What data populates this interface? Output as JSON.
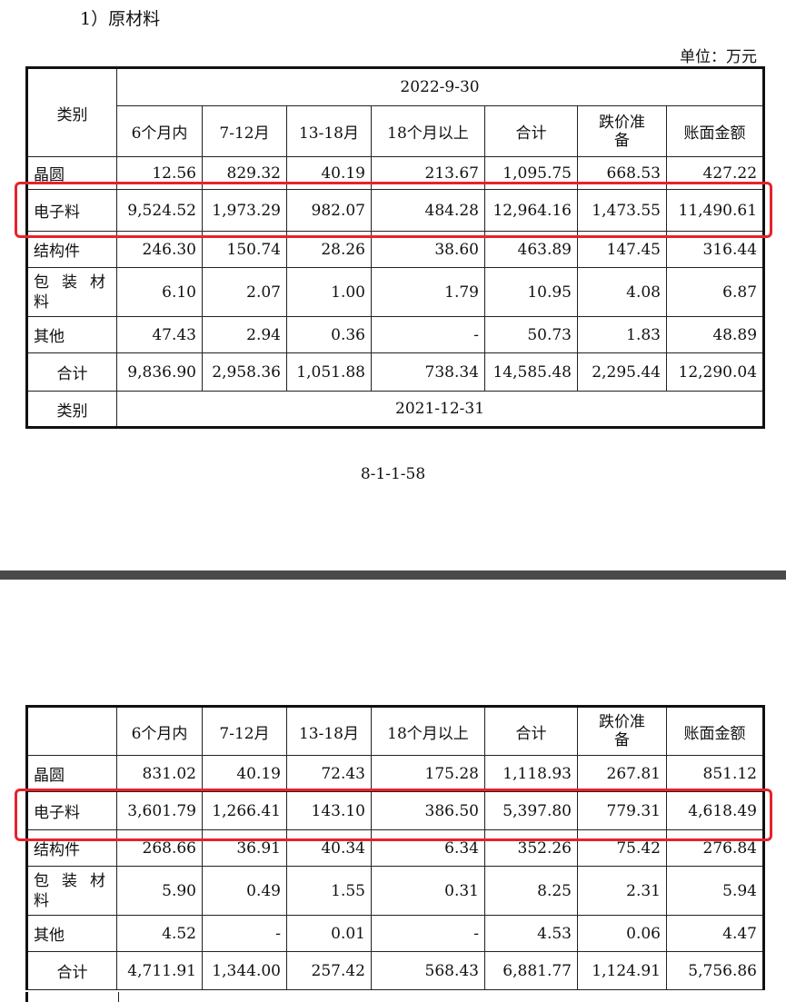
{
  "heading": "1）原材料",
  "unit": "单位：万元",
  "page_number": "8-1-1-58",
  "columns": [
    "6个月内",
    "7-12月",
    "13-18月",
    "18个月以上",
    "合计",
    "跌价准备",
    "账面金额"
  ],
  "category_header": "类别",
  "table_2022": {
    "period": "2022-9-30",
    "rows": [
      {
        "category": "晶圆",
        "values": [
          "12.56",
          "829.32",
          "40.19",
          "213.67",
          "1,095.75",
          "668.53",
          "427.22"
        ]
      },
      {
        "category": "电子料",
        "values": [
          "9,524.52",
          "1,973.29",
          "982.07",
          "484.28",
          "12,964.16",
          "1,473.55",
          "11,490.61"
        ]
      },
      {
        "category": "结构件",
        "values": [
          "246.30",
          "150.74",
          "28.26",
          "38.60",
          "463.89",
          "147.45",
          "316.44"
        ]
      },
      {
        "category": "包装材料",
        "values": [
          "6.10",
          "2.07",
          "1.00",
          "1.79",
          "10.95",
          "4.08",
          "6.87"
        ]
      },
      {
        "category": "其他",
        "values": [
          "47.43",
          "2.94",
          "0.36",
          "-",
          "50.73",
          "1.83",
          "48.89"
        ]
      },
      {
        "category": "合计",
        "values": [
          "9,836.90",
          "2,958.36",
          "1,051.88",
          "738.34",
          "14,585.48",
          "2,295.44",
          "12,290.04"
        ]
      }
    ]
  },
  "table_2021": {
    "period": "2021-12-31",
    "rows": [
      {
        "category": "晶圆",
        "values": [
          "831.02",
          "40.19",
          "72.43",
          "175.28",
          "1,118.93",
          "267.81",
          "851.12"
        ]
      },
      {
        "category": "电子料",
        "values": [
          "3,601.79",
          "1,266.41",
          "143.10",
          "386.50",
          "5,397.80",
          "779.31",
          "4,618.49"
        ]
      },
      {
        "category": "结构件",
        "values": [
          "268.66",
          "36.91",
          "40.34",
          "6.34",
          "352.26",
          "75.42",
          "276.84"
        ]
      },
      {
        "category": "包装材料",
        "values": [
          "5.90",
          "0.49",
          "1.55",
          "0.31",
          "8.25",
          "2.31",
          "5.94"
        ]
      },
      {
        "category": "其他",
        "values": [
          "4.52",
          "-",
          "0.01",
          "-",
          "4.53",
          "0.06",
          "4.47"
        ]
      },
      {
        "category": "合计",
        "values": [
          "4,711.91",
          "1,344.00",
          "257.42",
          "568.43",
          "6,881.77",
          "1,124.91",
          "5,756.86"
        ]
      }
    ]
  },
  "highlight_color": "#e5232b"
}
